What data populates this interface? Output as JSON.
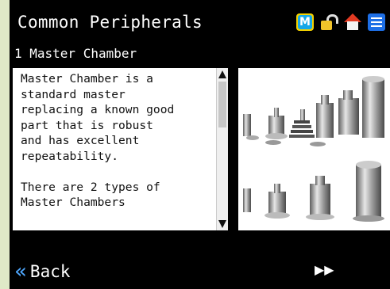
{
  "header": {
    "title": "Common Peripherals",
    "icons": [
      "m-logo-icon",
      "user-lock-icon",
      "home-icon",
      "menu-icon"
    ],
    "m_logo_letter": "M"
  },
  "section": {
    "title": "1 Master Chamber"
  },
  "description": {
    "text": "Master Chamber is a\nstandard master\nreplacing a known good\npart that is robust\nand has excellent\nrepeatability.\n\nThere are 2 types of\nMaster Chambers"
  },
  "footer": {
    "back_label": "Back",
    "forward_symbol": "▶▶"
  },
  "colors": {
    "background": "#dfe9c7",
    "panel": "#000000",
    "accent": "#4fa8ff",
    "m_logo": "#15a7e8",
    "home_roof": "#e23a22",
    "menu": "#1e6fe6"
  }
}
